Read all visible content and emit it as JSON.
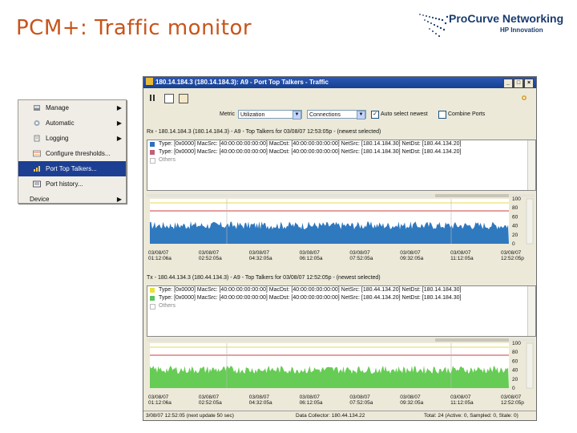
{
  "slide": {
    "title": "PCM+: Traffic monitor"
  },
  "logo": {
    "brand": "ProCurve Networking",
    "sub": "HP Innovation"
  },
  "context_menu": {
    "items": [
      {
        "label": "Manage",
        "icon": "manage-icon",
        "has_submenu": true
      },
      {
        "label": "Automatic",
        "icon": "automatic-icon",
        "has_submenu": true
      },
      {
        "label": "Logging",
        "icon": "logging-icon",
        "has_submenu": true
      },
      {
        "label": "Configure thresholds...",
        "icon": "thresholds-icon",
        "has_submenu": false
      },
      {
        "label": "Port Top Talkers...",
        "icon": "top-talkers-icon",
        "has_submenu": false,
        "selected": true
      },
      {
        "label": "Port history...",
        "icon": "port-history-icon",
        "has_submenu": false
      }
    ],
    "device_label": "Device"
  },
  "window": {
    "title": "180.14.184.3 (180.14.184.3): A9 - Port Top Talkers - Traffic",
    "metric_label": "Metric",
    "metric_value": "Utilization",
    "mode_value": "Connections",
    "auto_select_label": "Auto select newest",
    "combine_label": "Combine Ports",
    "section1_header": "Rx - 180.14.184.3 (180.14.184.3) - A9 - Top Talkers for 03/08/07 12:53:05p - (newest selected)",
    "section2_header": "Tx - 180.44.134.3 (180.44.134.3) - A9 - Top Talkers for 03/08/07 12:52:05p - (newest selected)",
    "legend1": [
      {
        "text": "Type: [0x0000] MacSrc: [40:00:00:00:00:00] MacDst: [40:00:00:00:00:00] NetSrc: [180.14.184.30] NetDst: [180.44.134.20]",
        "color": "#2f6fbf"
      },
      {
        "text": "Type: [0x0000] MacSrc: [40:00:00:00:00:00] MacDst: [40:00:00:00:00:00] NetSrc: [180.14.184.30] NetDst: [180.44.134.20]",
        "color": "#c0607a"
      },
      {
        "text": "Others",
        "color": "#ffffff"
      }
    ],
    "legend2": [
      {
        "text": "Type: [0x0000] MacSrc: [40:00:00:00:00:00] MacDst: [40:00:00:00:00:00] NetSrc: [180.44.134.20] NetDst: [180.14.184.30]",
        "color": "#e8e23a"
      },
      {
        "text": "Type: [0x0000] MacSrc: [40:00:00:00:00:00] MacDst: [40:00:00:00:00:00] NetSrc: [180.44.134.20] NetDst: [180.14.184.30]",
        "color": "#5fc25f"
      },
      {
        "text": "Others",
        "color": "#ffffff"
      }
    ],
    "x_labels": [
      [
        "03/08/07",
        "01:12:06a"
      ],
      [
        "03/08/07",
        "02:52:05a"
      ],
      [
        "03/08/07",
        "04:32:05a"
      ],
      [
        "03/08/07",
        "06:12:05a"
      ],
      [
        "03/08/07",
        "07:52:05a"
      ],
      [
        "03/08/07",
        "09:32:05a"
      ],
      [
        "03/08/07",
        "11:12:05a"
      ],
      [
        "03/08/07",
        "12:52:05p"
      ]
    ],
    "y_ticks": [
      "100",
      "80",
      "60",
      "40",
      "20",
      "0"
    ],
    "status_left": "3/08/07 12:52:05 (next update 50 sec)",
    "status_mid": "Data Collector: 180.44.134.22",
    "status_right": "Total: 24 (Active: 0, Sampled: 0, Stale: 0)"
  },
  "colors": {
    "title": "#c8541a",
    "titlebar": "#16408f",
    "graph1": "#2f79bf",
    "graph2": "#66cc55",
    "threshold_upper": "#e8d84a",
    "threshold_lower": "#d23c3c"
  }
}
